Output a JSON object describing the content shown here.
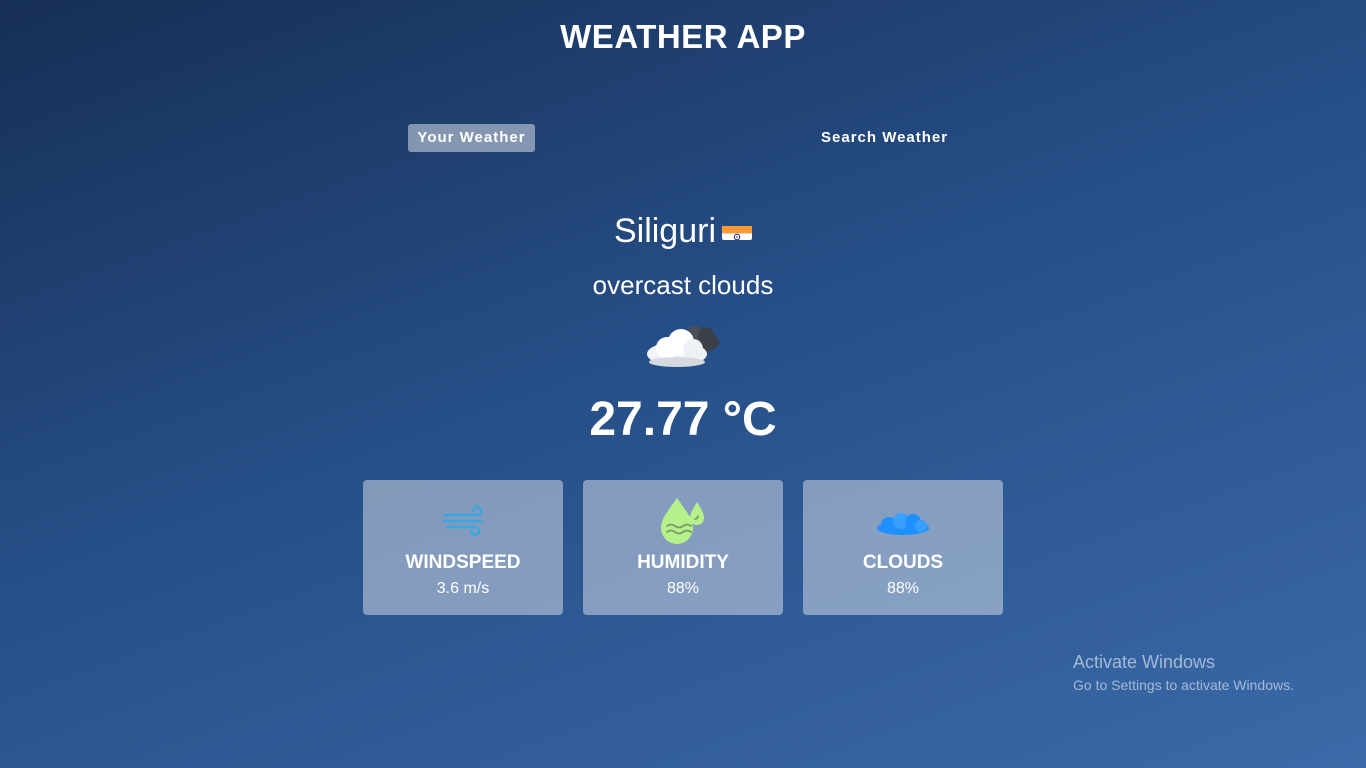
{
  "app": {
    "title": "WEATHER APP"
  },
  "tabs": [
    {
      "label": "Your Weather",
      "active": true
    },
    {
      "label": "Search Weather",
      "active": false
    }
  ],
  "weather": {
    "city": "Siliguri",
    "country_flag_icon": "india-flag-icon",
    "description": "overcast clouds",
    "condition_icon": "overcast-clouds-icon",
    "temperature": "27.77 °C"
  },
  "metrics": [
    {
      "label": "WINDSPEED",
      "value": "3.6 m/s",
      "icon": "wind-icon",
      "icon_color": "#3aa6e0"
    },
    {
      "label": "HUMIDITY",
      "value": "88%",
      "icon": "humidity-icon",
      "icon_color": "#b6f08a"
    },
    {
      "label": "CLOUDS",
      "value": "88%",
      "icon": "cloud-icon",
      "icon_color": "#1e90ff"
    }
  ],
  "os_watermark": {
    "title": "Activate Windows",
    "subtitle": "Go to Settings to activate Windows."
  },
  "colors": {
    "background_start": "#172f55",
    "background_end": "#3a6aa9",
    "card_background": "rgba(255,255,255,0.42)"
  }
}
